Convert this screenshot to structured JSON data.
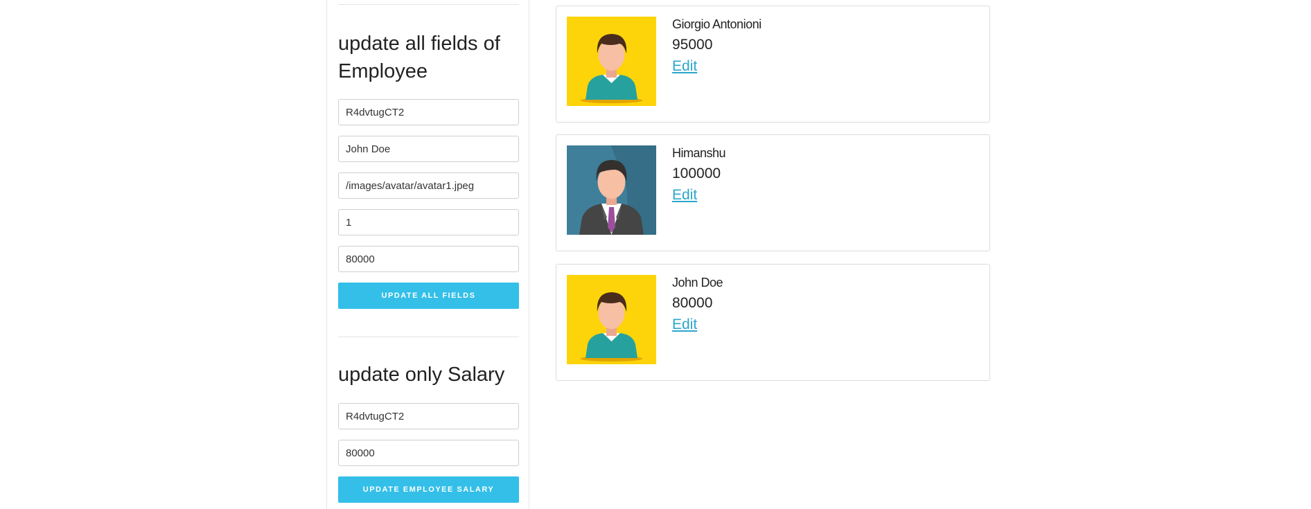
{
  "update_all": {
    "title": "update all fields of Employee",
    "fields": [
      {
        "value": "R4dvtugCT2"
      },
      {
        "value": "John Doe"
      },
      {
        "value": "/images/avatar/avatar1.jpeg"
      },
      {
        "value": "1"
      },
      {
        "value": "80000"
      }
    ],
    "button_label": "UPDATE ALL FIELDS"
  },
  "update_salary": {
    "title": "update only Salary",
    "fields": [
      {
        "value": "R4dvtugCT2"
      },
      {
        "value": "80000"
      }
    ],
    "button_label": "UPDATE EMPLOYEE SALARY"
  },
  "employees": [
    {
      "name": "Giorgio Antonioni",
      "salary": "95000",
      "edit_label": "Edit",
      "avatar": "avatar-casual-yellow-icon"
    },
    {
      "name": "Himanshu",
      "salary": "100000",
      "edit_label": "Edit",
      "avatar": "avatar-suit-blue-icon"
    },
    {
      "name": "John Doe",
      "salary": "80000",
      "edit_label": "Edit",
      "avatar": "avatar-casual-yellow-icon"
    }
  ],
  "colors": {
    "accent": "#33bfe8",
    "link": "#2ba6cb",
    "avatar_yellow_bg": "#fdd40a",
    "avatar_blue_bg": "#3f7f9a"
  }
}
